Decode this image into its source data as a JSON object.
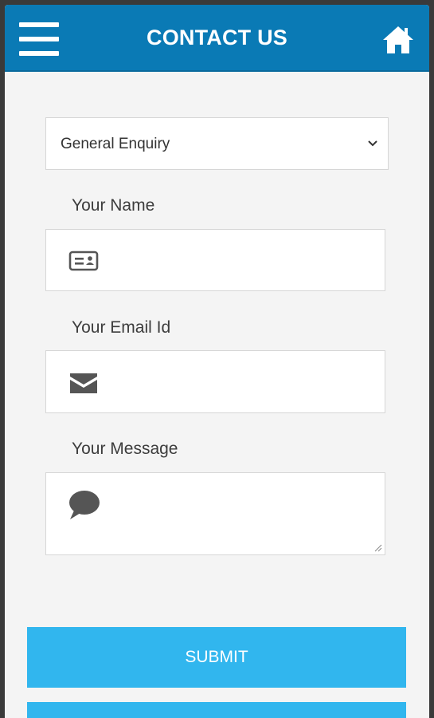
{
  "header": {
    "title": "CONTACT US",
    "menu_icon": "hamburger-menu-icon",
    "home_icon": "home-icon",
    "bg_color": "#0a7ab5"
  },
  "form": {
    "enquiry_type": {
      "selected": "General Enquiry"
    },
    "name": {
      "label": "Your Name",
      "value": "",
      "icon": "id-card-icon"
    },
    "email": {
      "label": "Your Email Id",
      "value": "",
      "icon": "envelope-icon"
    },
    "message": {
      "label": "Your Message",
      "value": "",
      "icon": "speech-bubble-icon"
    },
    "submit_label": "SUBMIT",
    "accent_color": "#31b6ee"
  }
}
